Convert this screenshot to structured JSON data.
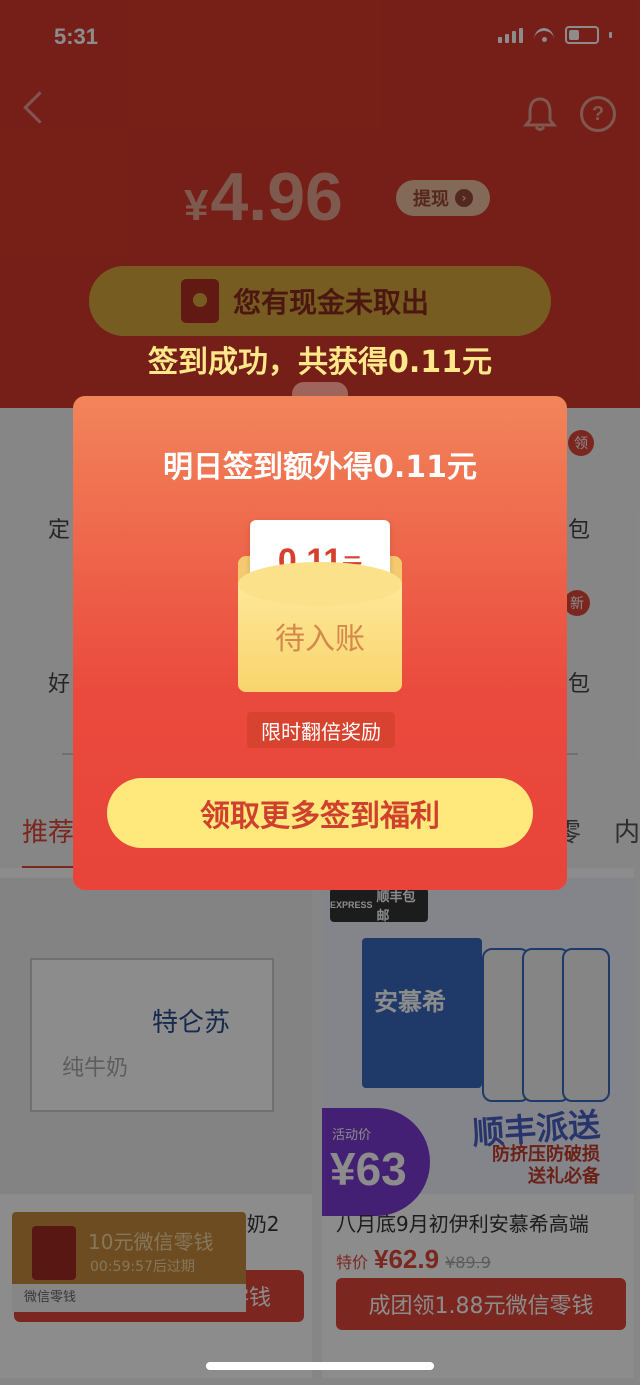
{
  "status_bar": {
    "time": "5:31"
  },
  "header": {
    "currency": "¥",
    "balance": "4.96",
    "withdraw_label": "提现",
    "cash_notice": "您有现金未取出",
    "sign_success": "签到成功，共获得0.11元"
  },
  "background": {
    "task_row1_left": "定",
    "task_row1_right": "包",
    "task_row2_left": "好",
    "task_row2_right": "包",
    "badge1": "领",
    "badge2": "新",
    "tab_left": "推荐",
    "tab_right": "内",
    "tab_right2": "零"
  },
  "products": [
    {
      "title": "【8月产】蒙牛特仑苏纯牛奶2",
      "button": "零钱",
      "image_text": "特仑苏",
      "image_text2": "纯牛奶"
    },
    {
      "badge": "顺丰包邮",
      "badge_sub": "EXPRESS",
      "brand": "安慕希",
      "promo": "顺丰派送",
      "promo_sub1": "防挤压防破损",
      "promo_sub2": "送礼必备",
      "activity_label": "活动价",
      "activity_price": "¥63",
      "title": "八月底9月初伊利安慕希高端",
      "price_tag": "特价",
      "price_now": "¥62.9",
      "price_old": "¥89.9",
      "button": "成团领1.88元微信零钱"
    }
  ],
  "wallet_toast": {
    "amount": "10元微信零钱",
    "countdown": "00:59:57后过期",
    "footer": "微信零钱"
  },
  "modal": {
    "title": "明日签到额外得0.11元",
    "amount": "0.11",
    "unit": "元",
    "status": "待入账",
    "double_tag": "限时翻倍奖励",
    "claim_button": "领取更多签到福利"
  }
}
